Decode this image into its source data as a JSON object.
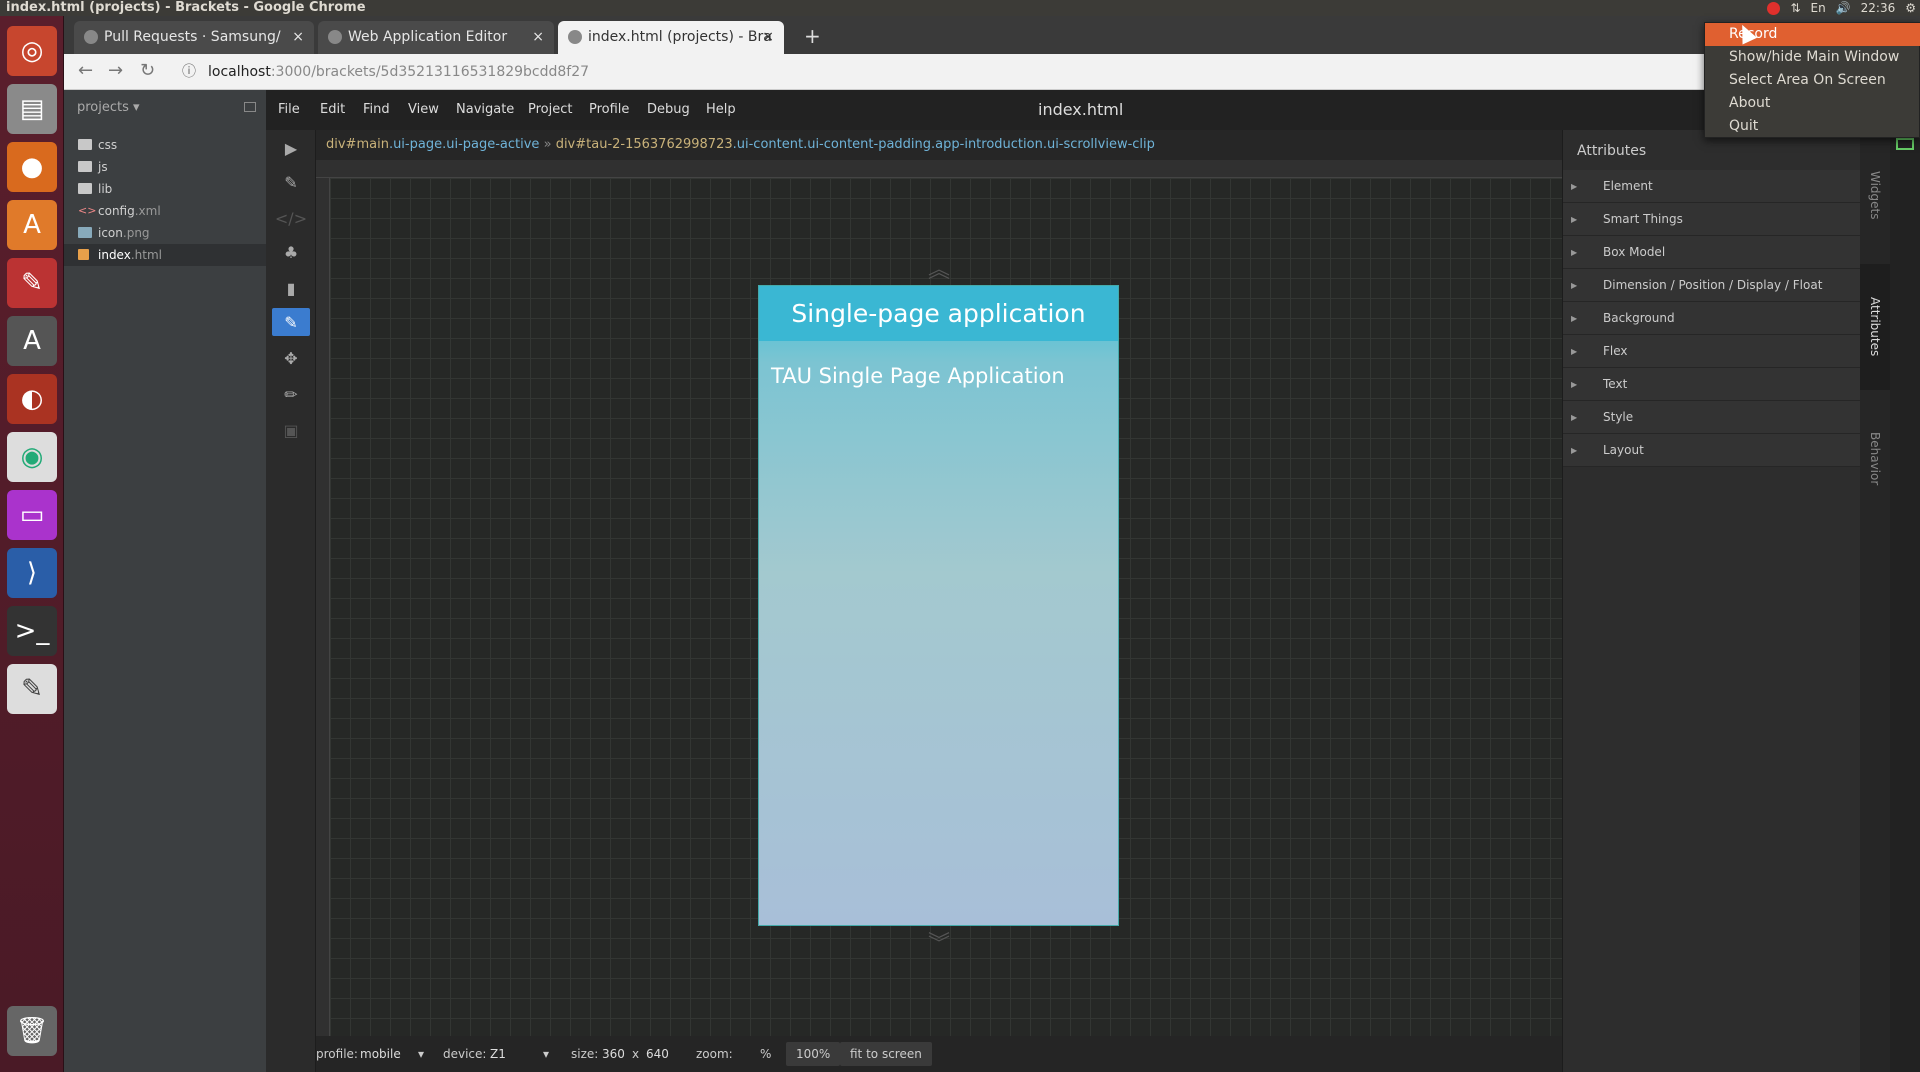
{
  "window_title": "index.html (projects) - Brackets - Google Chrome",
  "system_bar": {
    "lang": "En",
    "time": "22:36"
  },
  "tabs": [
    {
      "label": "Pull Requests · Samsung/",
      "close": "×"
    },
    {
      "label": "Web Application Editor",
      "close": "×"
    },
    {
      "label": "index.html (projects) - Bra",
      "close": "×"
    }
  ],
  "new_tab": "+",
  "address": {
    "host": "localhost",
    "path": ":3000/brackets/5d35213116531829bcdd8f27"
  },
  "sidebar": {
    "project_label": "projects",
    "files": [
      {
        "name": "css",
        "ext": ""
      },
      {
        "name": "js",
        "ext": ""
      },
      {
        "name": "lib",
        "ext": ""
      },
      {
        "name": "config",
        "ext": ".xml"
      },
      {
        "name": "icon",
        "ext": ".png"
      },
      {
        "name": "index",
        "ext": ".html"
      }
    ]
  },
  "menu": {
    "items": [
      "File",
      "Edit",
      "Find",
      "View",
      "Navigate",
      "Project",
      "Profile",
      "Debug",
      "Help"
    ],
    "doc_title": "index.html"
  },
  "breadcrumb": {
    "seg1_id": "div#main",
    "seg1_cls": ".ui-page.ui-page-active",
    "sep": "»",
    "seg2_id": "div#tau-2-1563762998723",
    "seg2_cls": ".ui-content.ui-content-padding.app-introduction.ui-scrollview-clip"
  },
  "preview": {
    "header": "Single-page application",
    "body": "TAU Single Page Application"
  },
  "status": {
    "profile_label": "profile:",
    "profile_value": "mobile",
    "device_label": "device:",
    "device_value": "Z1",
    "size_label": "size:",
    "width": "360",
    "x": "x",
    "height": "640",
    "zoom_label": "zoom:",
    "zoom_unit": "%",
    "zoom_value": "100%",
    "fit": "fit to screen"
  },
  "attributes": {
    "title": "Attributes",
    "sections": [
      "Element",
      "Smart Things",
      "Box Model",
      "Dimension / Position / Display / Float",
      "Background",
      "Flex",
      "Text",
      "Style",
      "Layout"
    ]
  },
  "side_tabs": [
    "Widgets",
    "Attributes",
    "Behavior"
  ],
  "popup_menu": [
    "Record",
    "Show/hide Main Window",
    "Select Area On Screen",
    "About",
    "Quit"
  ]
}
